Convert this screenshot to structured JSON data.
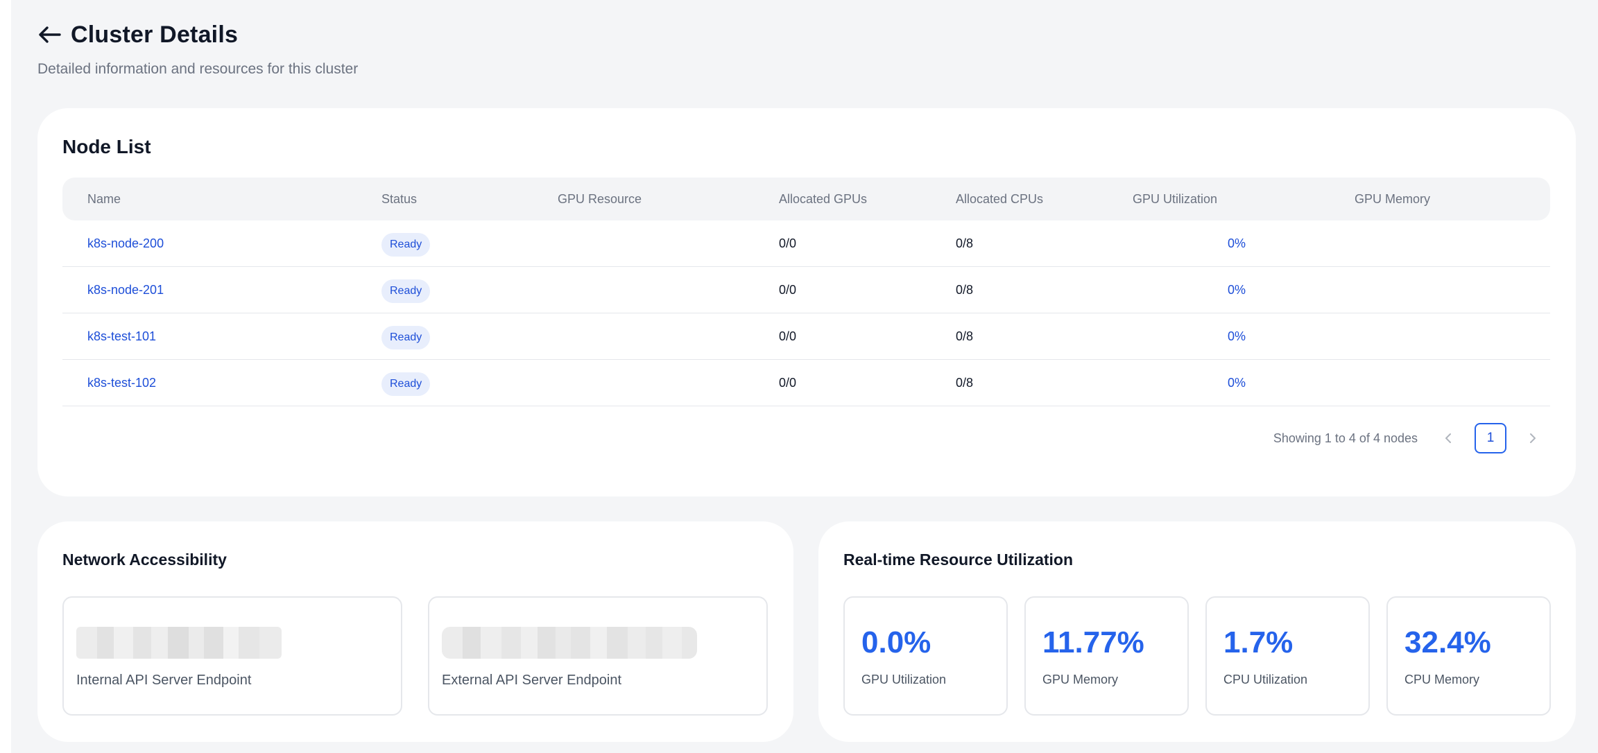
{
  "header": {
    "title": "Cluster Details",
    "subtitle": "Detailed information and resources for this cluster"
  },
  "node_list": {
    "title": "Node List",
    "columns": [
      "Name",
      "Status",
      "GPU Resource",
      "Allocated GPUs",
      "Allocated CPUs",
      "GPU Utilization",
      "GPU Memory"
    ],
    "rows": [
      {
        "name": "k8s-node-200",
        "status": "Ready",
        "gpu_resource": "",
        "allocated_gpus": "0/0",
        "allocated_cpus": "0/8",
        "gpu_utilization": "0%",
        "gpu_memory": ""
      },
      {
        "name": "k8s-node-201",
        "status": "Ready",
        "gpu_resource": "",
        "allocated_gpus": "0/0",
        "allocated_cpus": "0/8",
        "gpu_utilization": "0%",
        "gpu_memory": ""
      },
      {
        "name": "k8s-test-101",
        "status": "Ready",
        "gpu_resource": "",
        "allocated_gpus": "0/0",
        "allocated_cpus": "0/8",
        "gpu_utilization": "0%",
        "gpu_memory": ""
      },
      {
        "name": "k8s-test-102",
        "status": "Ready",
        "gpu_resource": "",
        "allocated_gpus": "0/0",
        "allocated_cpus": "0/8",
        "gpu_utilization": "0%",
        "gpu_memory": ""
      }
    ],
    "pagination": {
      "showing": "Showing 1 to 4 of 4 nodes",
      "current_page": "1",
      "prev_icon": "chevron-left-icon",
      "next_icon": "chevron-right-icon"
    }
  },
  "network": {
    "title": "Network Accessibility",
    "endpoints": [
      {
        "label": "Internal API Server Endpoint"
      },
      {
        "label": "External API Server Endpoint"
      }
    ]
  },
  "resources": {
    "title": "Real-time Resource Utilization",
    "metrics": [
      {
        "value": "0.0%",
        "label": "GPU Utilization"
      },
      {
        "value": "11.77%",
        "label": "GPU Memory"
      },
      {
        "value": "1.7%",
        "label": "CPU Utilization"
      },
      {
        "value": "32.4%",
        "label": "CPU Memory"
      }
    ]
  },
  "colors": {
    "accent": "#2563eb",
    "link": "#1d4ed8",
    "badge_bg": "#e8eefc",
    "page_bg": "#f4f5f7",
    "card_bg": "#ffffff"
  },
  "icons": {
    "back": "arrow-left-icon"
  }
}
